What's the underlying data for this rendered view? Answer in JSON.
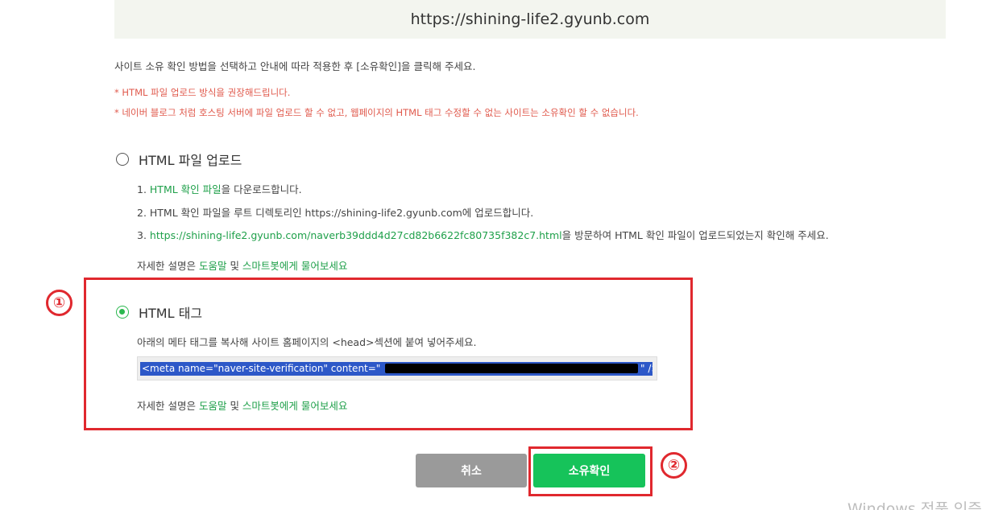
{
  "site_url": "https://shining-life2.gyunb.com",
  "intro": "사이트 소유 확인 방법을 선택하고 안내에 따라 적용한 후 [소유확인]을 클릭해 주세요.",
  "warnings": [
    "* HTML 파일 업로드 방식을 권장해드립니다.",
    "* 네이버 블로그 처럼 호스팅 서버에 파일 업로드 할 수 없고, 웹페이지의 HTML 태그 수정할 수 없는 사이트는 소유확인 할 수 없습니다."
  ],
  "methods": {
    "file_upload": {
      "label": "HTML 파일 업로드",
      "selected": false,
      "step1_prefix": "1. ",
      "step1_link": "HTML 확인 파일",
      "step1_suffix": "을 다운로드합니다.",
      "step2": "2. HTML 확인 파일을 루트 디렉토리인 https://shining-life2.gyunb.com에 업로드합니다.",
      "step3_prefix": "3. ",
      "step3_link": "https://shining-life2.gyunb.com/naverb39ddd4d27cd82b6622fc80735f382c7.html",
      "step3_suffix": "을 방문하여 HTML 확인 파일이 업로드되었는지 확인해 주세요."
    },
    "html_tag": {
      "label": "HTML 태그",
      "selected": true,
      "description": "아래의 메타 태그를 복사해 사이트 홈페이지의 <head>섹션에 붙여 넣어주세요.",
      "meta_tag_start": "<meta name=\"naver-site-verification\" content=\"",
      "meta_tag_end": "\" />"
    }
  },
  "help": {
    "prefix": "자세한 설명은 ",
    "help_link": "도움말",
    "middle": " 및 ",
    "bot_link": "스마트봇에게 물어보세요"
  },
  "markers": [
    "①",
    "②"
  ],
  "buttons": {
    "cancel": "취소",
    "confirm": "소유확인"
  },
  "watermark": "Windows 정품 인증",
  "colors": {
    "accent_green": "#16c35a",
    "link_green": "#1fa04a",
    "warning_red": "#e05a4d",
    "annotation_red": "#e0282e",
    "selection_blue": "#2d58c8"
  }
}
